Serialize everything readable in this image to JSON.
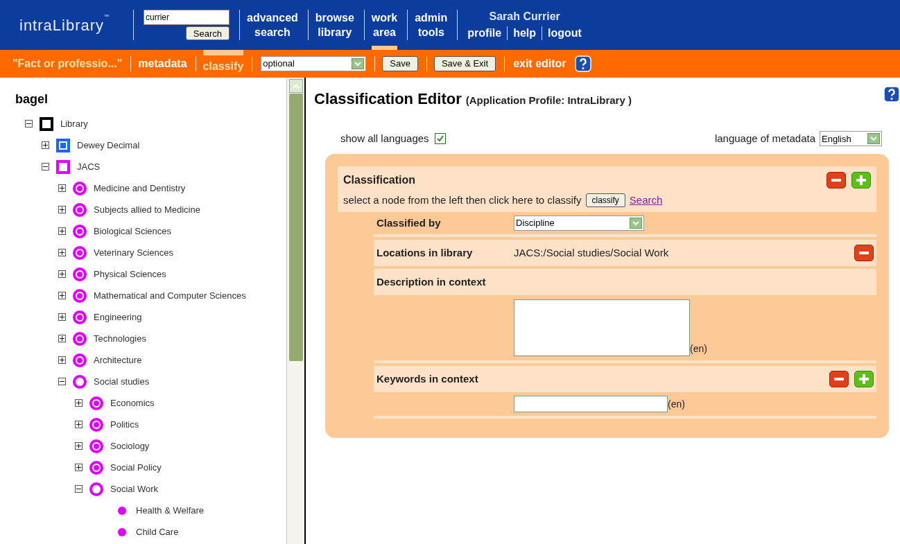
{
  "header": {
    "logo": "intraLibrary",
    "logo_mark": "™",
    "search": {
      "value": "currier",
      "button": "Search"
    },
    "nav": [
      {
        "label": "advanced\nsearch",
        "selected": false
      },
      {
        "label": "browse\nlibrary",
        "selected": false
      },
      {
        "label": "work\narea",
        "selected": true
      },
      {
        "label": "admin\ntools",
        "selected": false
      }
    ],
    "user": "Sarah Currier",
    "user_links": [
      "profile",
      "help",
      "logout"
    ]
  },
  "editor_bar": {
    "title": "\"Fact or professio...\"",
    "tabs": [
      {
        "label": "metadata",
        "selected": false
      },
      {
        "label": "classify",
        "selected": true
      }
    ],
    "select": "optional",
    "buttons": [
      "Save",
      "Save & Exit"
    ],
    "exit": "exit editor"
  },
  "tree": {
    "title": "bagel",
    "nodes": [
      {
        "label": "Library",
        "kind": "square",
        "color": "#000000",
        "expanded": true,
        "children": [
          {
            "label": "Dewey Decimal",
            "kind": "square",
            "color": "#1a66ff",
            "expanded": false
          },
          {
            "label": "JACS",
            "kind": "square",
            "color": "#dd00ff",
            "expanded": true,
            "children": [
              {
                "label": "Medicine and Dentistry",
                "kind": "ring",
                "color": "#dd00ff",
                "expanded": false
              },
              {
                "label": "Subjects allied to Medicine",
                "kind": "ring",
                "color": "#dd00ff",
                "expanded": false
              },
              {
                "label": "Biological Sciences",
                "kind": "ring",
                "color": "#dd00ff",
                "expanded": false
              },
              {
                "label": "Veterinary Sciences",
                "kind": "ring",
                "color": "#dd00ff",
                "expanded": false
              },
              {
                "label": "Physical Sciences",
                "kind": "ring",
                "color": "#dd00ff",
                "expanded": false
              },
              {
                "label": "Mathematical and Computer Sciences",
                "kind": "ring",
                "color": "#dd00ff",
                "expanded": false
              },
              {
                "label": "Engineering",
                "kind": "ring",
                "color": "#dd00ff",
                "expanded": false
              },
              {
                "label": "Technologies",
                "kind": "ring",
                "color": "#dd00ff",
                "expanded": false
              },
              {
                "label": "Architecture",
                "kind": "ring",
                "color": "#dd00ff",
                "expanded": false
              },
              {
                "label": "Social studies",
                "kind": "ring",
                "color": "#dd00ff",
                "expanded": true,
                "children": [
                  {
                    "label": "Economics",
                    "kind": "ring",
                    "color": "#dd00ff",
                    "expanded": false
                  },
                  {
                    "label": "Politics",
                    "kind": "ring",
                    "color": "#dd00ff",
                    "expanded": false
                  },
                  {
                    "label": "Sociology",
                    "kind": "ring",
                    "color": "#dd00ff",
                    "expanded": false
                  },
                  {
                    "label": "Social Policy",
                    "kind": "ring",
                    "color": "#dd00ff",
                    "expanded": false
                  },
                  {
                    "label": "Social Work",
                    "kind": "ring",
                    "color": "#dd00ff",
                    "expanded": true,
                    "children": [
                      {
                        "label": "Health & Welfare",
                        "kind": "dot",
                        "color": "#dd00ff"
                      },
                      {
                        "label": "Child Care",
                        "kind": "dot",
                        "color": "#dd00ff"
                      }
                    ]
                  }
                ]
              }
            ]
          }
        ]
      }
    ]
  },
  "editor": {
    "title": "Classification Editor",
    "subtitle": "(Application Profile: IntraLibrary )",
    "show_all_languages": {
      "label": "show all languages",
      "checked": true
    },
    "language": {
      "label": "language of metadata",
      "value": "English"
    },
    "section": {
      "title": "Classification",
      "hint": "select a node from the left then click here to classify",
      "button": "classify",
      "link": "Search",
      "classified_by": {
        "label": "Classified by",
        "value": "Discipline"
      },
      "locations": {
        "label": "Locations in library",
        "value": "JACS:/Social studies/Social Work"
      },
      "description": {
        "label": "Description in context",
        "lang": "(en)"
      },
      "keywords": {
        "label": "Keywords in context",
        "lang": "(en)"
      }
    }
  }
}
